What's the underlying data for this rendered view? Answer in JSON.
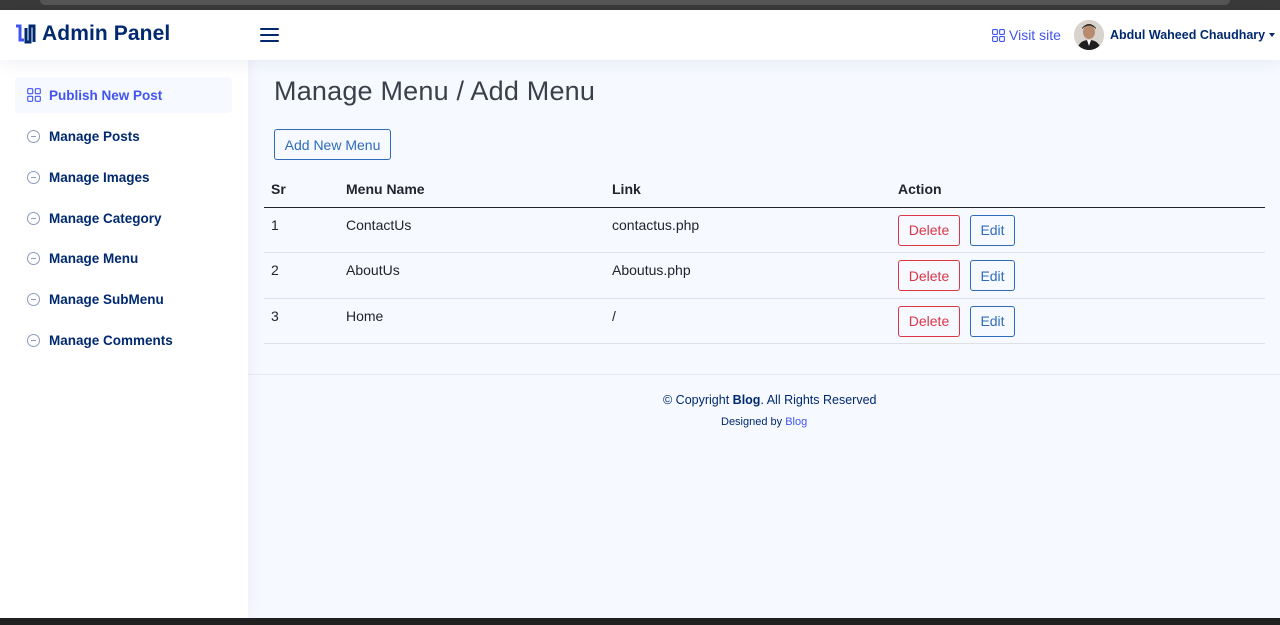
{
  "header": {
    "brand": "Admin Panel",
    "visit_site": "Visit site",
    "user_name": "Abdul Waheed Chaudhary"
  },
  "sidebar": {
    "items": [
      {
        "label": "Publish New Post",
        "icon": "grid-icon",
        "active": true
      },
      {
        "label": "Manage Posts",
        "icon": "circle-minus-icon"
      },
      {
        "label": "Manage Images",
        "icon": "circle-minus-icon"
      },
      {
        "label": "Manage Category",
        "icon": "circle-minus-icon"
      },
      {
        "label": "Manage Menu",
        "icon": "circle-minus-icon"
      },
      {
        "label": "Manage SubMenu",
        "icon": "circle-minus-icon"
      },
      {
        "label": "Manage Comments",
        "icon": "circle-minus-icon"
      }
    ]
  },
  "main": {
    "title": "Manage Menu / Add Menu",
    "add_button": "Add New Menu",
    "table": {
      "headers": [
        "Sr",
        "Menu Name",
        "Link",
        "Action"
      ],
      "rows": [
        {
          "sr": "1",
          "name": "ContactUs",
          "link": "contactus.php",
          "delete": "Delete",
          "edit": "Edit"
        },
        {
          "sr": "2",
          "name": "AboutUs",
          "link": "Aboutus.php",
          "delete": "Delete",
          "edit": "Edit"
        },
        {
          "sr": "3",
          "name": "Home",
          "link": "/",
          "delete": "Delete",
          "edit": "Edit"
        }
      ]
    }
  },
  "footer": {
    "copyright_prefix": "© Copyright",
    "copyright_brand": "Blog",
    "copyright_suffix": ". All Rights Reserved",
    "designed_by": "Designed by",
    "designed_link": "Blog"
  },
  "colors": {
    "accent": "#4154f1",
    "navy": "#012970",
    "danger": "#dc3545",
    "primary_outline": "#2f6cb8",
    "background": "#f6f9ff"
  }
}
